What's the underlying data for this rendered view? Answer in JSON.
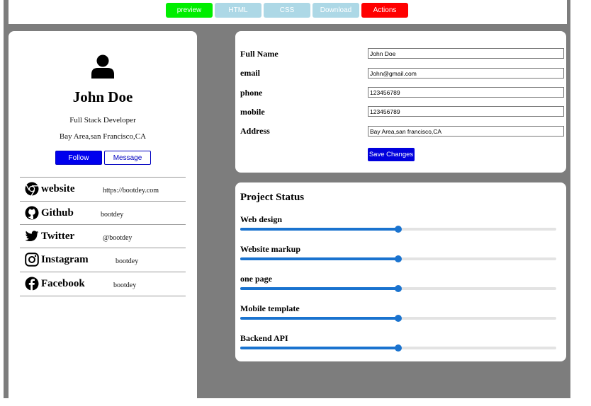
{
  "toolbar": {
    "buttons": [
      {
        "label": "preview",
        "color": "#00ee00"
      },
      {
        "label": "HTML",
        "color": "#add8e6"
      },
      {
        "label": "CSS",
        "color": "#add8e6"
      },
      {
        "label": "Download",
        "color": "#add8e6"
      },
      {
        "label": "Actions",
        "color": "#ff0000"
      }
    ]
  },
  "profile": {
    "avatar_icon": "user-icon",
    "name": "John Doe",
    "title": "Full Stack Developer",
    "location": "Bay Area,san Francisco,CA",
    "follow_label": "Follow",
    "message_label": "Message"
  },
  "social": [
    {
      "icon": "chrome-icon",
      "name": "website",
      "value": "https://bootdey.com"
    },
    {
      "icon": "github-icon",
      "name": "Github",
      "value": "bootdey"
    },
    {
      "icon": "twitter-icon",
      "name": "Twitter",
      "value": "@bootdey"
    },
    {
      "icon": "instagram-icon",
      "name": "Instagram",
      "value": "bootdey"
    },
    {
      "icon": "facebook-icon",
      "name": "Facebook",
      "value": "bootdey"
    }
  ],
  "form": {
    "fields": [
      {
        "label": "Full Name",
        "value": "John Doe"
      },
      {
        "label": "email",
        "value": "John@gmail.com"
      },
      {
        "label": "phone",
        "value": "123456789"
      },
      {
        "label": "mobile",
        "value": "123456789"
      },
      {
        "label": "Address",
        "value": "Bay Area,san francisco,CA"
      }
    ],
    "save_label": "Save Changes"
  },
  "project": {
    "title": "Project Status",
    "items": [
      {
        "label": "Web design",
        "progress": 0.5
      },
      {
        "label": "Website markup",
        "progress": 0.5
      },
      {
        "label": "one page",
        "progress": 0.5
      },
      {
        "label": "Mobile template",
        "progress": 0.5
      },
      {
        "label": "Backend API",
        "progress": 0.5
      }
    ]
  },
  "colors": {
    "accent": "#0000ee",
    "progress": "#1a73cf",
    "background": "#7d7d7d"
  }
}
